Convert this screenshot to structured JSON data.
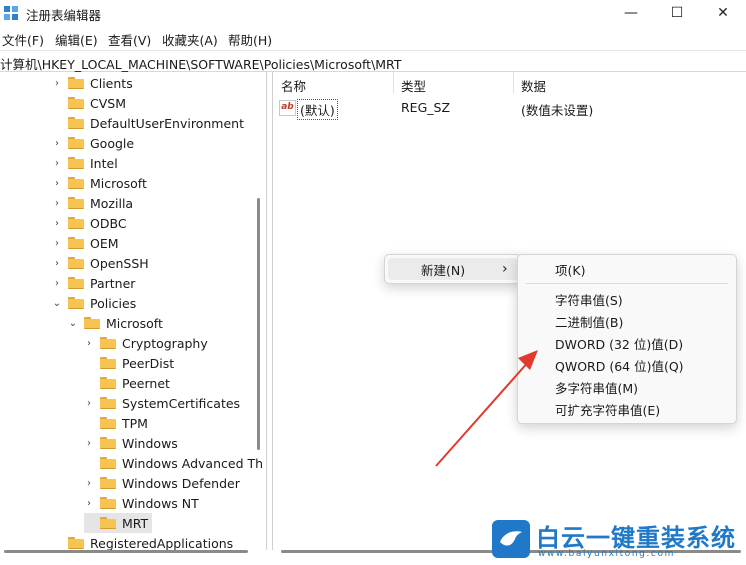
{
  "window": {
    "title": "注册表编辑器",
    "minimize": "—",
    "maximize": "☐",
    "close": "✕"
  },
  "menu": [
    "文件(F)",
    "编辑(E)",
    "查看(V)",
    "收藏夹(A)",
    "帮助(H)"
  ],
  "address": "计算机\\HKEY_LOCAL_MACHINE\\SOFTWARE\\Policies\\Microsoft\\MRT",
  "tree": [
    {
      "label": "Clients",
      "chevron": "›"
    },
    {
      "label": "CVSM",
      "chevron": ""
    },
    {
      "label": "DefaultUserEnvironment",
      "chevron": ""
    },
    {
      "label": "Google",
      "chevron": "›"
    },
    {
      "label": "Intel",
      "chevron": "›"
    },
    {
      "label": "Microsoft",
      "chevron": "›"
    },
    {
      "label": "Mozilla",
      "chevron": "›"
    },
    {
      "label": "ODBC",
      "chevron": "›"
    },
    {
      "label": "OEM",
      "chevron": "›"
    },
    {
      "label": "OpenSSH",
      "chevron": "›"
    },
    {
      "label": "Partner",
      "chevron": "›"
    },
    {
      "label": "Policies",
      "chevron": "⌄"
    },
    {
      "label": "Microsoft",
      "chevron": "⌄"
    },
    {
      "label": "Cryptography",
      "chevron": "›"
    },
    {
      "label": "PeerDist",
      "chevron": ""
    },
    {
      "label": "Peernet",
      "chevron": ""
    },
    {
      "label": "SystemCertificates",
      "chevron": "›"
    },
    {
      "label": "TPM",
      "chevron": ""
    },
    {
      "label": "Windows",
      "chevron": "›"
    },
    {
      "label": "Windows Advanced Th",
      "chevron": ""
    },
    {
      "label": "Windows Defender",
      "chevron": "›"
    },
    {
      "label": "Windows NT",
      "chevron": "›"
    },
    {
      "label": "MRT",
      "chevron": ""
    },
    {
      "label": "RegisteredApplications",
      "chevron": ""
    }
  ],
  "list": {
    "columns": [
      "名称",
      "类型",
      "数据"
    ],
    "rows": [
      {
        "icon": "ab",
        "name": "(默认)",
        "type": "REG_SZ",
        "data": "(数值未设置)"
      }
    ]
  },
  "context_menu": {
    "new_label": "新建(N)",
    "arrow": "›"
  },
  "submenu": [
    "项(K)",
    "字符串值(S)",
    "二进制值(B)",
    "DWORD (32 位)值(D)",
    "QWORD (64 位)值(Q)",
    "多字符串值(M)",
    "可扩充字符串值(E)"
  ],
  "watermark": {
    "brand": "白云一键重装系统",
    "url": "www.baiyunxitong.com"
  },
  "colors": {
    "arrow": "#e23a2e",
    "brand": "#1f78c8",
    "folder": "#f5c451"
  }
}
